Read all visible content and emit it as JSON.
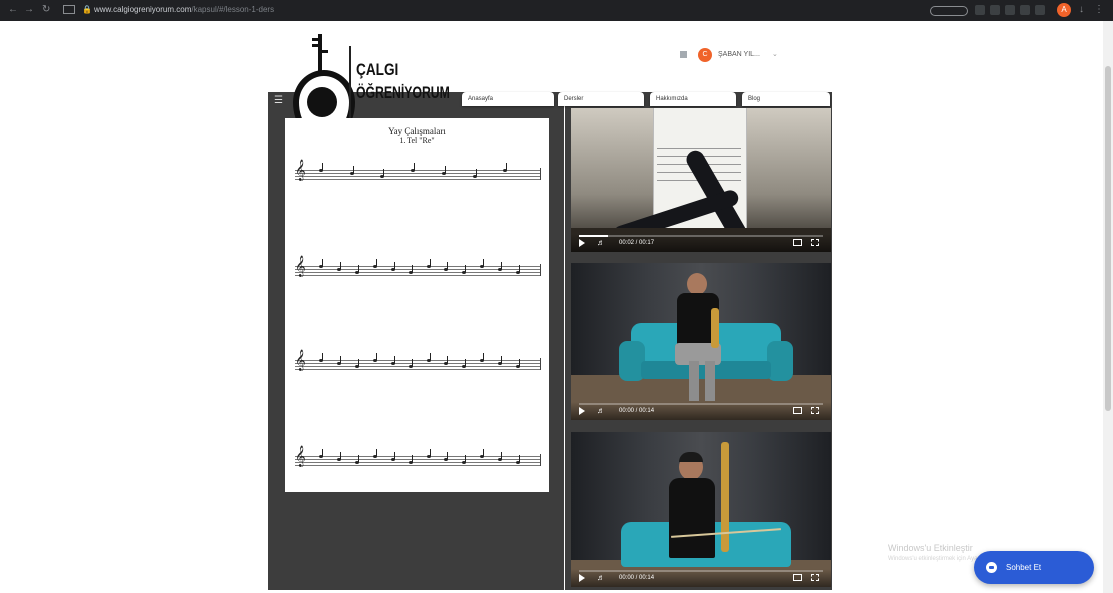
{
  "browser": {
    "url_domain": "www.calgiogreniyorum.com",
    "url_path": "/kapsul/#/lesson-1-ders",
    "profile_initial": "A"
  },
  "logo": {
    "line1": "ÇALGI",
    "line2": "ÖĞRENİYORUM"
  },
  "user": {
    "avatar_initial": "C",
    "name": "ŞABAN YIL..."
  },
  "nav": {
    "tabs": [
      {
        "label": "Anasayfa"
      },
      {
        "label": "Dersler"
      },
      {
        "label": "Hakkımızda"
      },
      {
        "label": "Blog"
      }
    ]
  },
  "sheet": {
    "title": "Yay Çalışmaları",
    "subtitle": "1. Tel \"Re\""
  },
  "videos": [
    {
      "time": "00:02 / 00:17",
      "progress": 0.12
    },
    {
      "time": "00:00 / 00:14",
      "progress": 0.0
    },
    {
      "time": "00:00 / 00:14",
      "progress": 0.0
    }
  ],
  "watermark": {
    "title": "Windows'u Etkinleştir",
    "subtitle": "Windows'u etkinleştirmek için Ayarlar'a gidin."
  },
  "chat": {
    "label": "Sohbet Et"
  },
  "colors": {
    "accent_orange": "#f0632a",
    "chat_blue": "#2b5cd6",
    "panel_dark": "#3d3d3d",
    "sofa_teal": "#2aa7b8"
  }
}
